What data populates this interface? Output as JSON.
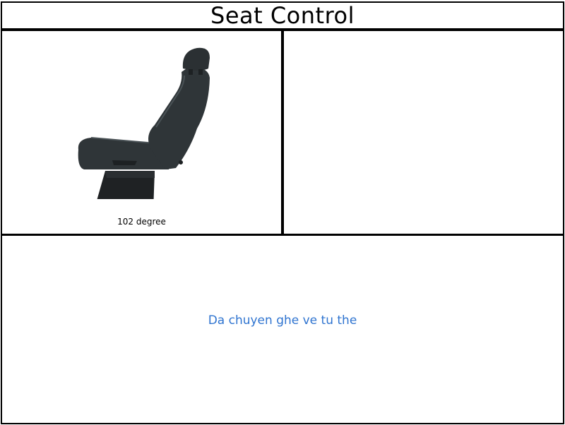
{
  "header": {
    "title": "Seat Control"
  },
  "seat_panel": {
    "angle_label": "102 degree",
    "angle_degrees": 102,
    "image": "car-seat-icon"
  },
  "status": {
    "message": "Da chuyen ghe ve tu the",
    "color": "#2f74d0"
  }
}
